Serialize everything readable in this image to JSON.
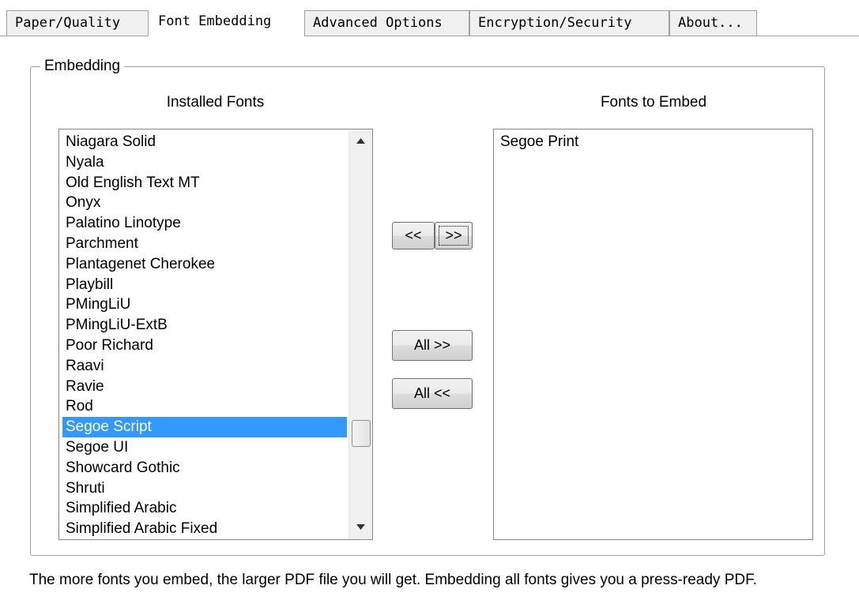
{
  "tabs": [
    {
      "label": "Paper/Quality",
      "active": false
    },
    {
      "label": "Font Embedding",
      "active": true
    },
    {
      "label": "Advanced Options",
      "active": false
    },
    {
      "label": "Encryption/Security",
      "active": false
    },
    {
      "label": "About...",
      "active": false
    }
  ],
  "group": {
    "legend": "Embedding"
  },
  "installed": {
    "title": "Installed Fonts",
    "items": [
      "Niagara Solid",
      "Nyala",
      "Old English Text MT",
      "Onyx",
      "Palatino Linotype",
      "Parchment",
      "Plantagenet Cherokee",
      "Playbill",
      "PMingLiU",
      "PMingLiU-ExtB",
      "Poor Richard",
      "Raavi",
      "Ravie",
      "Rod",
      "Segoe Script",
      "Segoe UI",
      "Showcard Gothic",
      "Shruti",
      "Simplified Arabic",
      "Simplified Arabic Fixed"
    ],
    "selected": "Segoe Script"
  },
  "embed": {
    "title": "Fonts to Embed",
    "items": [
      "Segoe Print"
    ]
  },
  "buttons": {
    "remove": "<<",
    "add": ">>",
    "add_all": "All >>",
    "remove_all": "All <<"
  },
  "icons": {
    "scroll_up": "scroll-up-arrow-icon",
    "scroll_down": "scroll-down-arrow-icon"
  },
  "colors": {
    "selection": "#3399ff",
    "tab_background": "#f0f0f0"
  },
  "footer": "The more fonts you embed, the larger PDF file you will get. Embedding all fonts gives you a press-ready PDF."
}
